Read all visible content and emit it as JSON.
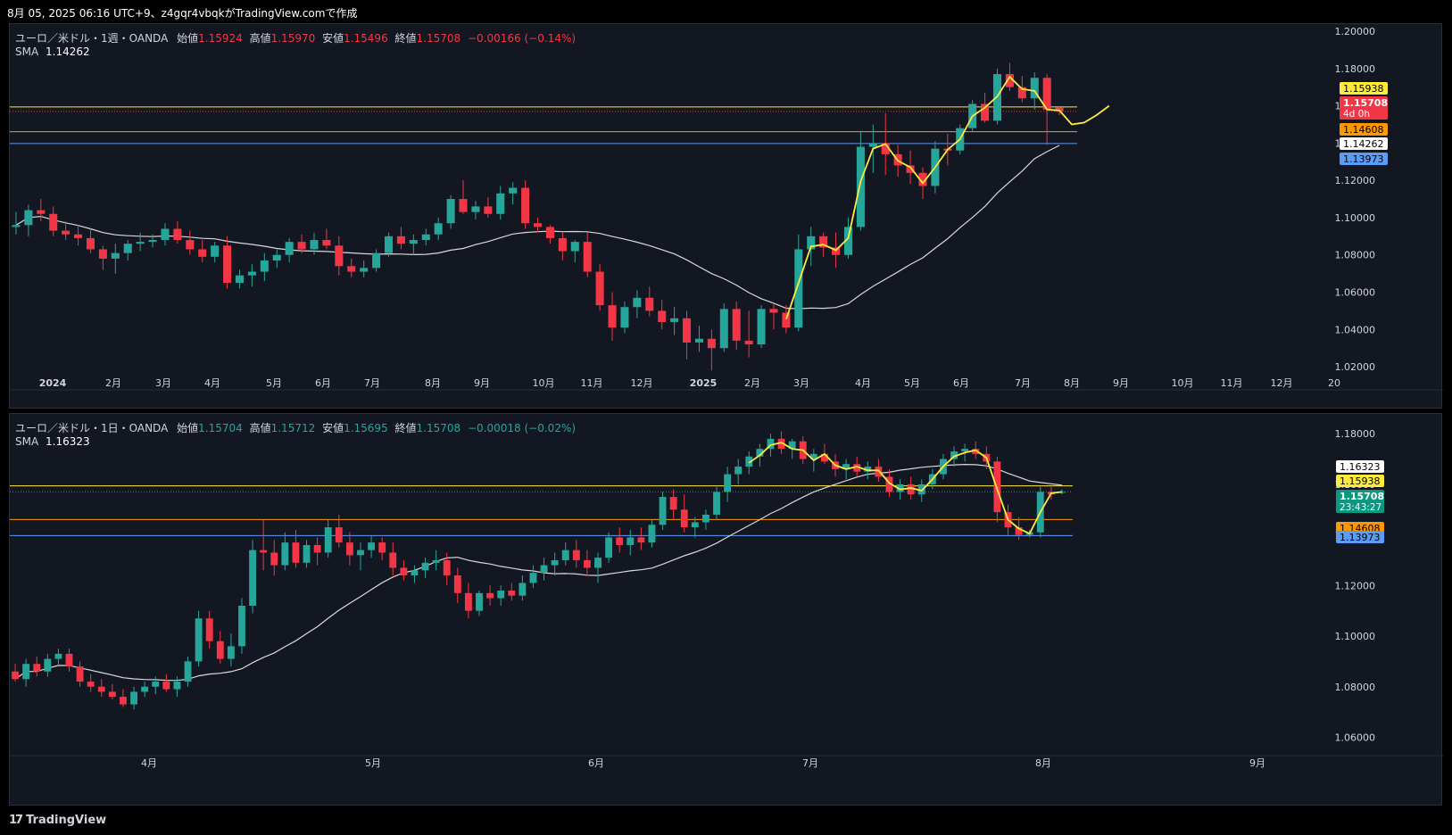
{
  "header": {
    "title": "8月 05, 2025 06:16 UTC+9、z4gqr4vbqkがTradingView.comで作成"
  },
  "footer": {
    "brand": "TradingView"
  },
  "colors": {
    "up": "#26a69a",
    "down": "#f23645",
    "sma": "#d9d9d9",
    "wave": "#ffeb3b",
    "line_yellow": "#ffeb3b",
    "line_orange": "#ff9800",
    "line_blue": "#5b9cf6",
    "bg": "#131722"
  },
  "charts": [
    {
      "legend": {
        "symbol": "ユーロ／米ドル・1週・OANDA",
        "open_label": "始値",
        "open": "1.15924",
        "high_label": "高値",
        "high": "1.15970",
        "low_label": "安値",
        "low": "1.15496",
        "close_label": "終値",
        "close": "1.15708",
        "change": "−0.00166 (−0.14%)",
        "sma_label": "SMA",
        "sma": "1.14262"
      },
      "y_ticks": [
        "1.20000",
        "1.18000",
        "1.16000",
        "1.14000",
        "1.12000",
        "1.10000",
        "1.08000",
        "1.06000",
        "1.04000",
        "1.02000"
      ],
      "x_ticks": [
        "2024",
        "2月",
        "3月",
        "4月",
        "5月",
        "6月",
        "7月",
        "8月",
        "9月",
        "10月",
        "11月",
        "12月",
        "2025",
        "2月",
        "3月",
        "4月",
        "5月",
        "6月",
        "7月",
        "8月",
        "9月",
        "10月",
        "11月",
        "12月",
        "20"
      ],
      "price_tags": [
        {
          "value": "1.15938",
          "kind": "yellow"
        },
        {
          "value": "1.15708",
          "sub": "4d 0h",
          "kind": "red"
        },
        {
          "value": "1.14608",
          "kind": "orange"
        },
        {
          "value": "1.14262",
          "kind": "white"
        },
        {
          "value": "1.13973",
          "kind": "blue"
        }
      ]
    },
    {
      "legend": {
        "symbol": "ユーロ／米ドル・1日・OANDA",
        "open_label": "始値",
        "open": "1.15704",
        "high_label": "高値",
        "high": "1.15712",
        "low_label": "安値",
        "low": "1.15695",
        "close_label": "終値",
        "close": "1.15708",
        "change": "−0.00018 (−0.02%)",
        "sma_label": "SMA",
        "sma": "1.16323"
      },
      "y_ticks": [
        "1.18000",
        "1.16000",
        "1.14000",
        "1.12000",
        "1.10000",
        "1.08000",
        "1.06000"
      ],
      "x_ticks": [
        "4月",
        "5月",
        "6月",
        "7月",
        "8月",
        "9月"
      ],
      "price_tags": [
        {
          "value": "1.16323",
          "kind": "white"
        },
        {
          "value": "1.15938",
          "kind": "yellow"
        },
        {
          "value": "1.15708",
          "sub": "23:43:27",
          "kind": "green"
        },
        {
          "value": "1.14608",
          "kind": "orange"
        },
        {
          "value": "1.13973",
          "kind": "blue"
        }
      ]
    }
  ],
  "chart_data": [
    {
      "type": "candlestick",
      "timeframe": "1週",
      "ylim": [
        1.01,
        1.2
      ],
      "h_lines": [
        1.15938,
        1.14608,
        1.13973
      ],
      "candles": [
        [
          1.095,
          1.103,
          1.091,
          1.096
        ],
        [
          1.096,
          1.107,
          1.09,
          1.104
        ],
        [
          1.104,
          1.11,
          1.098,
          1.102
        ],
        [
          1.102,
          1.106,
          1.09,
          1.093
        ],
        [
          1.093,
          1.098,
          1.088,
          1.091
        ],
        [
          1.091,
          1.096,
          1.085,
          1.089
        ],
        [
          1.089,
          1.094,
          1.081,
          1.083
        ],
        [
          1.083,
          1.085,
          1.072,
          1.078
        ],
        [
          1.078,
          1.086,
          1.07,
          1.081
        ],
        [
          1.081,
          1.088,
          1.077,
          1.086
        ],
        [
          1.086,
          1.092,
          1.082,
          1.087
        ],
        [
          1.087,
          1.091,
          1.084,
          1.088
        ],
        [
          1.088,
          1.097,
          1.085,
          1.094
        ],
        [
          1.094,
          1.098,
          1.086,
          1.088
        ],
        [
          1.088,
          1.093,
          1.08,
          1.083
        ],
        [
          1.083,
          1.088,
          1.076,
          1.079
        ],
        [
          1.079,
          1.087,
          1.076,
          1.085
        ],
        [
          1.085,
          1.09,
          1.062,
          1.065
        ],
        [
          1.065,
          1.072,
          1.062,
          1.069
        ],
        [
          1.069,
          1.075,
          1.063,
          1.071
        ],
        [
          1.071,
          1.081,
          1.066,
          1.077
        ],
        [
          1.077,
          1.083,
          1.073,
          1.08
        ],
        [
          1.08,
          1.089,
          1.076,
          1.087
        ],
        [
          1.087,
          1.091,
          1.081,
          1.083
        ],
        [
          1.083,
          1.092,
          1.08,
          1.088
        ],
        [
          1.088,
          1.094,
          1.083,
          1.085
        ],
        [
          1.085,
          1.09,
          1.069,
          1.074
        ],
        [
          1.074,
          1.078,
          1.068,
          1.071
        ],
        [
          1.071,
          1.077,
          1.068,
          1.073
        ],
        [
          1.073,
          1.083,
          1.071,
          1.081
        ],
        [
          1.081,
          1.092,
          1.079,
          1.09
        ],
        [
          1.09,
          1.095,
          1.083,
          1.086
        ],
        [
          1.086,
          1.091,
          1.08,
          1.088
        ],
        [
          1.088,
          1.094,
          1.085,
          1.091
        ],
        [
          1.091,
          1.1,
          1.088,
          1.097
        ],
        [
          1.097,
          1.112,
          1.094,
          1.11
        ],
        [
          1.11,
          1.12,
          1.102,
          1.103
        ],
        [
          1.103,
          1.109,
          1.099,
          1.106
        ],
        [
          1.106,
          1.111,
          1.1,
          1.102
        ],
        [
          1.102,
          1.117,
          1.099,
          1.113
        ],
        [
          1.113,
          1.119,
          1.107,
          1.116
        ],
        [
          1.116,
          1.12,
          1.094,
          1.097
        ],
        [
          1.097,
          1.1,
          1.092,
          1.095
        ],
        [
          1.095,
          1.096,
          1.086,
          1.089
        ],
        [
          1.089,
          1.092,
          1.077,
          1.082
        ],
        [
          1.082,
          1.088,
          1.076,
          1.087
        ],
        [
          1.087,
          1.092,
          1.068,
          1.071
        ],
        [
          1.071,
          1.075,
          1.05,
          1.053
        ],
        [
          1.053,
          1.06,
          1.034,
          1.041
        ],
        [
          1.041,
          1.055,
          1.038,
          1.052
        ],
        [
          1.052,
          1.061,
          1.046,
          1.057
        ],
        [
          1.057,
          1.063,
          1.047,
          1.05
        ],
        [
          1.05,
          1.056,
          1.04,
          1.044
        ],
        [
          1.044,
          1.052,
          1.037,
          1.046
        ],
        [
          1.046,
          1.05,
          1.024,
          1.033
        ],
        [
          1.033,
          1.042,
          1.028,
          1.035
        ],
        [
          1.035,
          1.04,
          1.018,
          1.03
        ],
        [
          1.03,
          1.054,
          1.028,
          1.051
        ],
        [
          1.051,
          1.055,
          1.029,
          1.034
        ],
        [
          1.034,
          1.05,
          1.025,
          1.032
        ],
        [
          1.032,
          1.053,
          1.03,
          1.051
        ],
        [
          1.051,
          1.054,
          1.04,
          1.049
        ],
        [
          1.049,
          1.053,
          1.038,
          1.041
        ],
        [
          1.041,
          1.091,
          1.039,
          1.083
        ],
        [
          1.083,
          1.095,
          1.074,
          1.09
        ],
        [
          1.09,
          1.092,
          1.079,
          1.084
        ],
        [
          1.084,
          1.092,
          1.073,
          1.08
        ],
        [
          1.08,
          1.1,
          1.078,
          1.095
        ],
        [
          1.095,
          1.146,
          1.093,
          1.138
        ],
        [
          1.138,
          1.15,
          1.124,
          1.14
        ],
        [
          1.14,
          1.156,
          1.123,
          1.134
        ],
        [
          1.134,
          1.139,
          1.122,
          1.128
        ],
        [
          1.128,
          1.136,
          1.118,
          1.124
        ],
        [
          1.124,
          1.127,
          1.11,
          1.117
        ],
        [
          1.117,
          1.141,
          1.113,
          1.137
        ],
        [
          1.137,
          1.145,
          1.128,
          1.136
        ],
        [
          1.136,
          1.15,
          1.134,
          1.148
        ],
        [
          1.148,
          1.163,
          1.146,
          1.161
        ],
        [
          1.161,
          1.167,
          1.151,
          1.152
        ],
        [
          1.152,
          1.18,
          1.15,
          1.177
        ],
        [
          1.177,
          1.183,
          1.168,
          1.17
        ],
        [
          1.17,
          1.176,
          1.162,
          1.164
        ],
        [
          1.164,
          1.178,
          1.158,
          1.175
        ],
        [
          1.175,
          1.177,
          1.139,
          1.158
        ],
        [
          1.159,
          1.16,
          1.155,
          1.157
        ]
      ]
    },
    {
      "type": "candlestick",
      "timeframe": "1日",
      "ylim": [
        1.045,
        1.185
      ],
      "h_lines": [
        1.15938,
        1.14608,
        1.13973
      ],
      "candles": [
        [
          1.086,
          1.089,
          1.082,
          1.083
        ],
        [
          1.083,
          1.091,
          1.08,
          1.089
        ],
        [
          1.089,
          1.092,
          1.084,
          1.086
        ],
        [
          1.086,
          1.093,
          1.084,
          1.091
        ],
        [
          1.091,
          1.095,
          1.088,
          1.093
        ],
        [
          1.093,
          1.095,
          1.086,
          1.088
        ],
        [
          1.088,
          1.09,
          1.08,
          1.082
        ],
        [
          1.082,
          1.085,
          1.078,
          1.08
        ],
        [
          1.08,
          1.083,
          1.076,
          1.078
        ],
        [
          1.078,
          1.081,
          1.075,
          1.076
        ],
        [
          1.076,
          1.079,
          1.072,
          1.073
        ],
        [
          1.073,
          1.08,
          1.071,
          1.078
        ],
        [
          1.078,
          1.082,
          1.076,
          1.08
        ],
        [
          1.08,
          1.084,
          1.077,
          1.082
        ],
        [
          1.082,
          1.085,
          1.078,
          1.079
        ],
        [
          1.079,
          1.084,
          1.076,
          1.082
        ],
        [
          1.082,
          1.092,
          1.08,
          1.09
        ],
        [
          1.09,
          1.11,
          1.088,
          1.107
        ],
        [
          1.107,
          1.11,
          1.095,
          1.098
        ],
        [
          1.098,
          1.102,
          1.089,
          1.091
        ],
        [
          1.091,
          1.101,
          1.088,
          1.096
        ],
        [
          1.096,
          1.115,
          1.093,
          1.112
        ],
        [
          1.112,
          1.138,
          1.109,
          1.134
        ],
        [
          1.134,
          1.146,
          1.126,
          1.133
        ],
        [
          1.133,
          1.138,
          1.124,
          1.128
        ],
        [
          1.128,
          1.141,
          1.126,
          1.137
        ],
        [
          1.137,
          1.142,
          1.127,
          1.129
        ],
        [
          1.129,
          1.138,
          1.127,
          1.136
        ],
        [
          1.136,
          1.139,
          1.128,
          1.133
        ],
        [
          1.133,
          1.146,
          1.131,
          1.143
        ],
        [
          1.143,
          1.148,
          1.135,
          1.137
        ],
        [
          1.137,
          1.141,
          1.128,
          1.132
        ],
        [
          1.132,
          1.137,
          1.126,
          1.134
        ],
        [
          1.134,
          1.14,
          1.131,
          1.137
        ],
        [
          1.137,
          1.139,
          1.13,
          1.133
        ],
        [
          1.133,
          1.137,
          1.124,
          1.127
        ],
        [
          1.127,
          1.13,
          1.122,
          1.124
        ],
        [
          1.124,
          1.128,
          1.121,
          1.126
        ],
        [
          1.126,
          1.131,
          1.123,
          1.129
        ],
        [
          1.129,
          1.134,
          1.126,
          1.13
        ],
        [
          1.13,
          1.133,
          1.12,
          1.124
        ],
        [
          1.124,
          1.127,
          1.113,
          1.117
        ],
        [
          1.117,
          1.121,
          1.107,
          1.11
        ],
        [
          1.11,
          1.118,
          1.108,
          1.117
        ],
        [
          1.117,
          1.12,
          1.112,
          1.115
        ],
        [
          1.115,
          1.12,
          1.112,
          1.118
        ],
        [
          1.118,
          1.121,
          1.114,
          1.116
        ],
        [
          1.116,
          1.124,
          1.114,
          1.121
        ],
        [
          1.121,
          1.128,
          1.119,
          1.125
        ],
        [
          1.125,
          1.131,
          1.122,
          1.128
        ],
        [
          1.128,
          1.133,
          1.124,
          1.13
        ],
        [
          1.13,
          1.137,
          1.128,
          1.134
        ],
        [
          1.134,
          1.138,
          1.127,
          1.13
        ],
        [
          1.13,
          1.134,
          1.124,
          1.127
        ],
        [
          1.127,
          1.133,
          1.121,
          1.131
        ],
        [
          1.131,
          1.141,
          1.129,
          1.139
        ],
        [
          1.139,
          1.143,
          1.133,
          1.136
        ],
        [
          1.136,
          1.142,
          1.132,
          1.139
        ],
        [
          1.139,
          1.143,
          1.134,
          1.137
        ],
        [
          1.137,
          1.146,
          1.135,
          1.144
        ],
        [
          1.144,
          1.157,
          1.142,
          1.155
        ],
        [
          1.155,
          1.158,
          1.146,
          1.15
        ],
        [
          1.15,
          1.156,
          1.141,
          1.143
        ],
        [
          1.143,
          1.147,
          1.139,
          1.145
        ],
        [
          1.145,
          1.15,
          1.142,
          1.148
        ],
        [
          1.148,
          1.159,
          1.146,
          1.157
        ],
        [
          1.157,
          1.167,
          1.153,
          1.164
        ],
        [
          1.164,
          1.17,
          1.16,
          1.167
        ],
        [
          1.167,
          1.173,
          1.164,
          1.171
        ],
        [
          1.171,
          1.176,
          1.167,
          1.174
        ],
        [
          1.174,
          1.18,
          1.171,
          1.178
        ],
        [
          1.178,
          1.181,
          1.172,
          1.174
        ],
        [
          1.174,
          1.178,
          1.17,
          1.177
        ],
        [
          1.177,
          1.179,
          1.168,
          1.17
        ],
        [
          1.17,
          1.174,
          1.165,
          1.172
        ],
        [
          1.172,
          1.176,
          1.168,
          1.169
        ],
        [
          1.169,
          1.172,
          1.163,
          1.166
        ],
        [
          1.166,
          1.17,
          1.162,
          1.168
        ],
        [
          1.168,
          1.171,
          1.163,
          1.165
        ],
        [
          1.165,
          1.169,
          1.162,
          1.167
        ],
        [
          1.167,
          1.17,
          1.161,
          1.163
        ],
        [
          1.163,
          1.166,
          1.155,
          1.157
        ],
        [
          1.157,
          1.162,
          1.154,
          1.16
        ],
        [
          1.16,
          1.163,
          1.154,
          1.156
        ],
        [
          1.156,
          1.162,
          1.153,
          1.16
        ],
        [
          1.16,
          1.166,
          1.158,
          1.164
        ],
        [
          1.164,
          1.172,
          1.162,
          1.17
        ],
        [
          1.17,
          1.175,
          1.167,
          1.173
        ],
        [
          1.173,
          1.176,
          1.169,
          1.174
        ],
        [
          1.174,
          1.177,
          1.17,
          1.172
        ],
        [
          1.172,
          1.175,
          1.166,
          1.169
        ],
        [
          1.169,
          1.171,
          1.145,
          1.149
        ],
        [
          1.149,
          1.152,
          1.14,
          1.143
        ],
        [
          1.143,
          1.147,
          1.138,
          1.14
        ],
        [
          1.14,
          1.142,
          1.139,
          1.141
        ],
        [
          1.141,
          1.159,
          1.139,
          1.157
        ],
        [
          1.157,
          1.159,
          1.154,
          1.156
        ],
        [
          1.157,
          1.158,
          1.156,
          1.157
        ]
      ]
    }
  ]
}
